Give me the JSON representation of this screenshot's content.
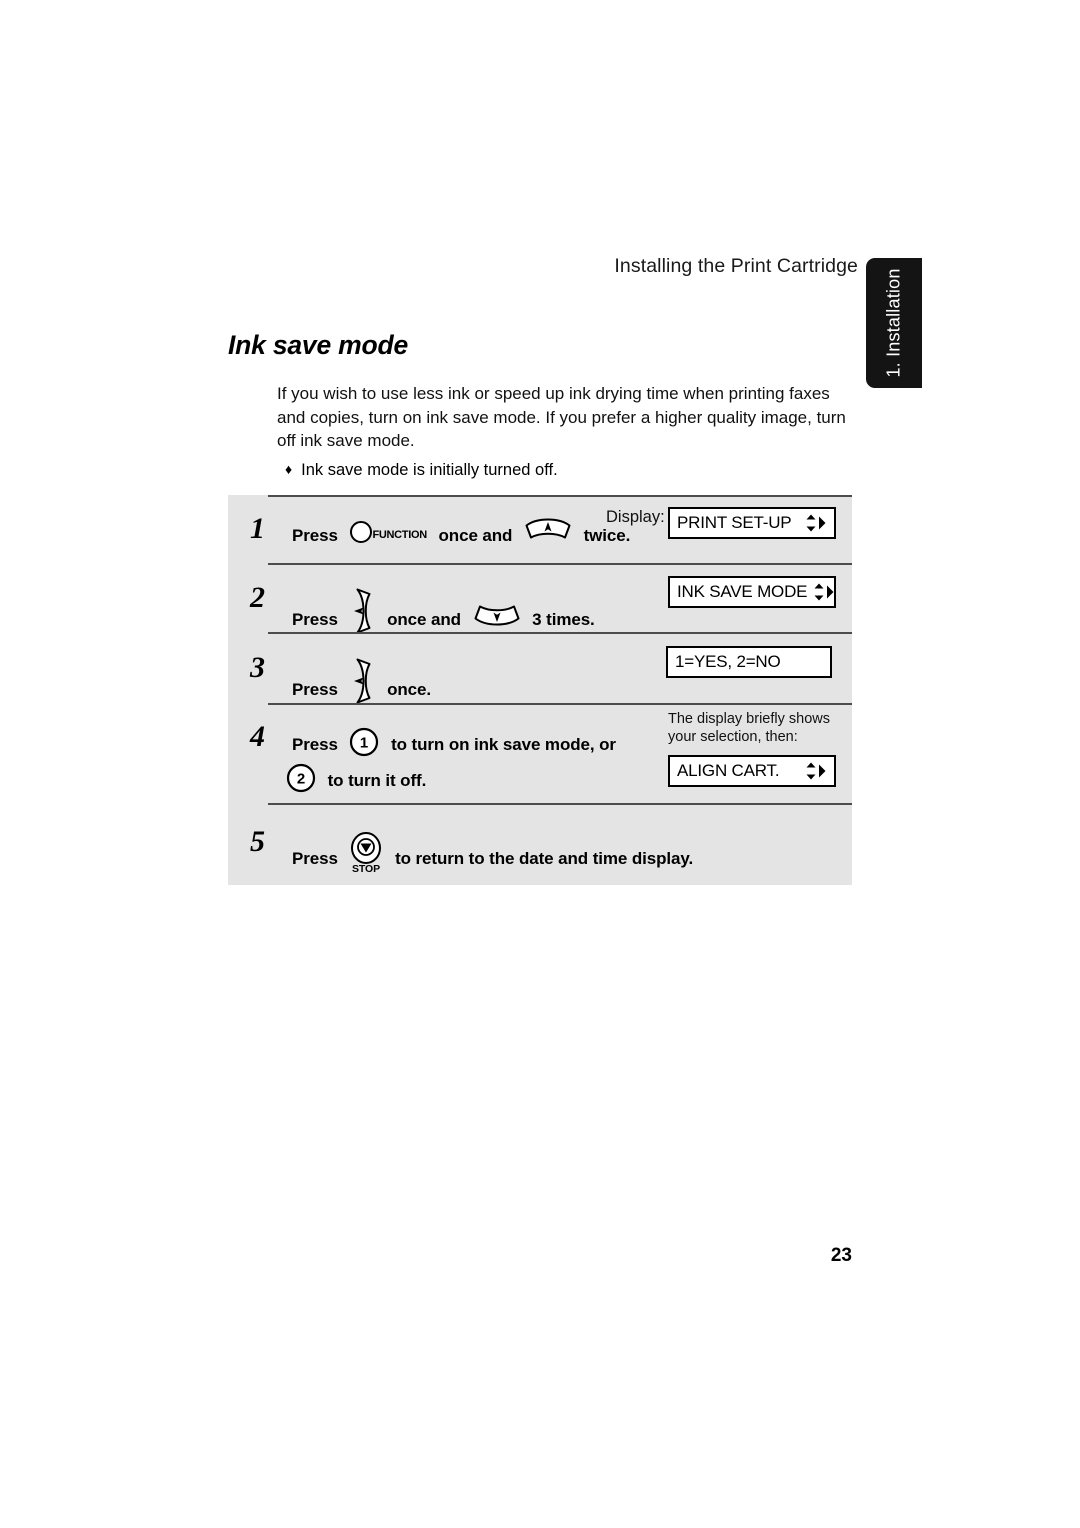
{
  "header": {
    "running_head": "Installing the Print Cartridge",
    "section_tab_label": "1. Installation"
  },
  "section": {
    "title": "Ink save mode",
    "intro": "If you wish to use less ink or speed up ink drying time when printing faxes and copies, turn on ink save mode. If you prefer a higher quality image, turn off ink save mode.",
    "bullet_symbol": "♦",
    "bullet_note": "Ink save mode is initially turned off."
  },
  "steps": {
    "display_label": "Display:",
    "items": [
      {
        "number": "1",
        "press_label": "Press",
        "text_middle": "once and",
        "text_end": "twice.",
        "icon_1": "function-key-icon",
        "icon_1_label": "FUNCTION",
        "icon_2": "down-arrow-key-icon",
        "display_value": "PRINT SET-UP",
        "display_has_arrows": true
      },
      {
        "number": "2",
        "press_label": "Press",
        "text_middle": "once and",
        "text_end": "3 times.",
        "icon_1": "right-arrow-key-icon",
        "icon_2": "up-arrow-key-icon",
        "display_value": "INK SAVE MODE",
        "display_has_arrows": true
      },
      {
        "number": "3",
        "press_label": "Press",
        "text_end": "once.",
        "icon_1": "right-arrow-key-icon",
        "display_value": "1=YES, 2=NO",
        "display_has_arrows": false
      },
      {
        "number": "4",
        "press_label": "Press",
        "key_1_label": "1",
        "text_after_key_1": "to turn on ink save mode, or",
        "key_2_label": "2",
        "text_after_key_2": "to turn it off.",
        "side_note": "The display briefly shows your selection, then:",
        "display_value": "ALIGN CART.",
        "display_has_arrows": true
      },
      {
        "number": "5",
        "press_label": "Press",
        "icon_1": "stop-key-icon",
        "icon_1_label": "STOP",
        "text_end": "to return to the date and time display."
      }
    ]
  },
  "footer": {
    "page_number": "23"
  },
  "colors": {
    "panel_background": "#e4e4e4",
    "tab_background": "#141414",
    "rule": "#4c4c4c",
    "ink": "#000000"
  }
}
